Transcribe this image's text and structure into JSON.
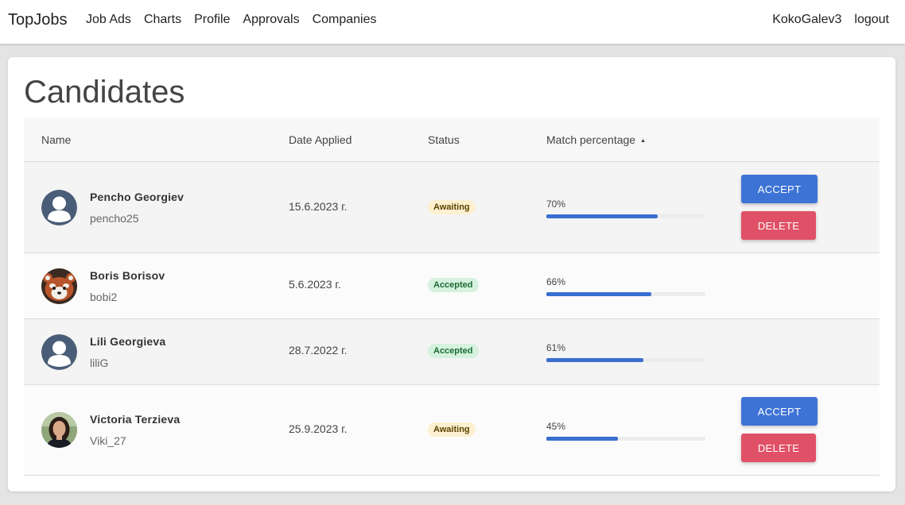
{
  "nav": {
    "brand": "TopJobs",
    "links": [
      "Job Ads",
      "Charts",
      "Profile",
      "Approvals",
      "Companies"
    ],
    "user": "KokoGalev3",
    "logout": "logout"
  },
  "page": {
    "title": "Candidates"
  },
  "table": {
    "headers": {
      "name": "Name",
      "date": "Date Applied",
      "status": "Status",
      "match": "Match percentage"
    },
    "rows": [
      {
        "name": "Pencho Georgiev",
        "username": "pencho25",
        "date": "15.6.2023 г.",
        "status": "Awaiting",
        "match": "70%",
        "match_value": 70,
        "avatar": "default-user-avatar",
        "actions": {
          "accept": "ACCEPT",
          "delete": "DELETE"
        }
      },
      {
        "name": "Boris Borisov",
        "username": "bobi2",
        "date": "5.6.2023 г.",
        "status": "Accepted",
        "match": "66%",
        "match_value": 66,
        "avatar": "red-panda-photo"
      },
      {
        "name": "Lili Georgieva",
        "username": "liliG",
        "date": "28.7.2022 г.",
        "status": "Accepted",
        "match": "61%",
        "match_value": 61,
        "avatar": "default-user-avatar"
      },
      {
        "name": "Victoria Terzieva",
        "username": "Viki_27",
        "date": "25.9.2023 г.",
        "status": "Awaiting",
        "match": "45%",
        "match_value": 45,
        "avatar": "woman-portrait-photo",
        "actions": {
          "accept": "ACCEPT",
          "delete": "DELETE"
        }
      }
    ]
  },
  "colors": {
    "accept": "#3e73d6",
    "delete": "#e05066",
    "progress": "#3a6fcf",
    "awaiting_bg": "#fdf0d0",
    "accepted_bg": "#d4f2dd"
  }
}
